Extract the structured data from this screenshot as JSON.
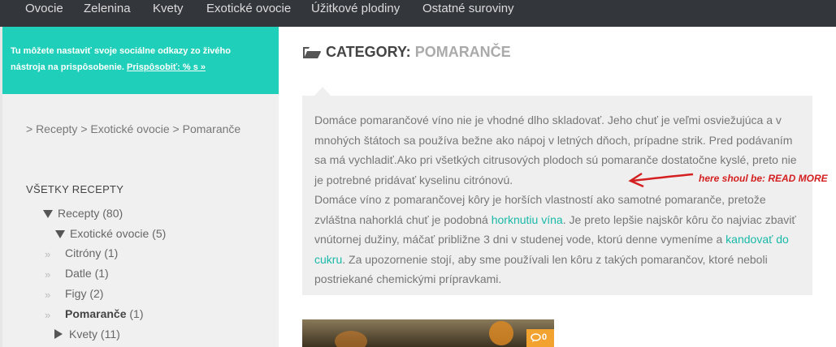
{
  "nav": {
    "items": [
      "Ovocie",
      "Zelenina",
      "Kvety",
      "Exotické ovocie",
      "Úžitkové plodiny",
      "Ostatné suroviny"
    ]
  },
  "notice": {
    "text": "Tu môžete nastaviť svoje sociálne odkazy zo živého nástroja na prispôsobenie.",
    "link": "Prispôsobiť: % s »"
  },
  "breadcrumb": "> Recepty > Exotické ovocie > Pomaranče",
  "widget": {
    "title": "VŠETKY RECEPTY",
    "tree": [
      {
        "label": "Recepty (80)",
        "expanded": true
      },
      {
        "label": "Exotické ovocie (5)",
        "expanded": true
      },
      {
        "label": "Citróny (1)"
      },
      {
        "label": "Datle (1)"
      },
      {
        "label": "Figy (2)"
      },
      {
        "label": "Pomaranče",
        "count": "(1)",
        "current": true
      },
      {
        "label": "Kvety (11)",
        "expanded": false
      }
    ],
    "bullet": "»"
  },
  "category": {
    "prefix": "CATEGORY:",
    "name": "POMARANČE",
    "icon": "folder-open-icon"
  },
  "excerpt": {
    "p1": "Domáce pomarančové víno nie je vhodné dlho skladovať. Jeho chuť je veľmi osviežujúca a v mnohých štátoch sa používa bežne ako nápoj v letných dňoch, prípadne strik. Pred podávaním sa má vychladiť.Ako pri všetkých citrusových plodoch sú pomaranče dostatočne kyslé, preto nie je potrebné pridávať kyselinu citrónovú.",
    "p2_a": "Domáce víno z pomarančovej kôry je horších vlastností ako samotné pomaranče, pretože zvláštna nahorklá chuť je podobná ",
    "link1": "horknutiu vína",
    "p2_b": ". Je preto lepšie najskôr kôru čo najviac zbaviť vnútornej dužiny, máčať približne 3 dni v studenej vode, ktorú denne vymeníme a ",
    "link2": "kandovať do cukru",
    "p2_c": ". Za upozornenie stojí, aby sme používali len kôru z takých pomarančov, ktoré neboli postriekané chemickými prípravkami."
  },
  "annotation": "here shoul be: READ MORE",
  "comments": {
    "count": "0",
    "icon": "comment-icon"
  },
  "colors": {
    "nav_bg": "#33363b",
    "accent": "#1fcfba",
    "link": "#19b9a8",
    "annotation": "#d42020",
    "badge": "#f2a22e"
  }
}
